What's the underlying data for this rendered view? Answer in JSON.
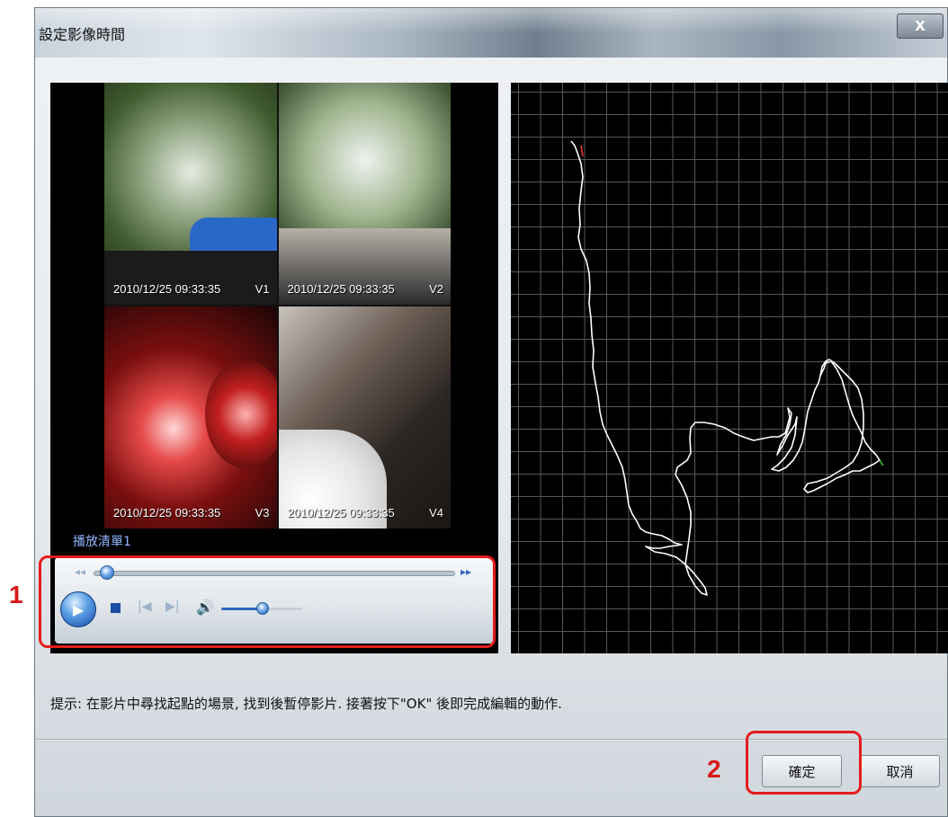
{
  "window": {
    "title": "設定影像時間",
    "close_label": "X"
  },
  "videos": [
    {
      "timestamp": "2010/12/25   09:33:35",
      "label": "V1"
    },
    {
      "timestamp": "2010/12/25   09:33:35",
      "label": "V2"
    },
    {
      "timestamp": "2010/12/25   09:33:35",
      "label": "V3"
    },
    {
      "timestamp": "2010/12/25   09:33:35",
      "label": "V4"
    }
  ],
  "player": {
    "playlist_label": "播放清單1",
    "seek_fraction": 0.02,
    "volume_fraction": 0.5,
    "icons": [
      "rewind-icon",
      "fast-forward-icon",
      "play-icon",
      "stop-icon",
      "previous-icon",
      "next-icon",
      "volume-icon"
    ]
  },
  "hint": "提示: 在影片中尋找起點的場景, 找到後暫停影片. 接著按下\"OK\" 後即完成編輯的動作.",
  "buttons": {
    "ok": "確定",
    "cancel": "取消"
  },
  "callouts": {
    "one": "1",
    "two": "2"
  },
  "colors": {
    "callout_red": "#e41c1c",
    "grid": "#575757",
    "track": "#ffffff"
  }
}
